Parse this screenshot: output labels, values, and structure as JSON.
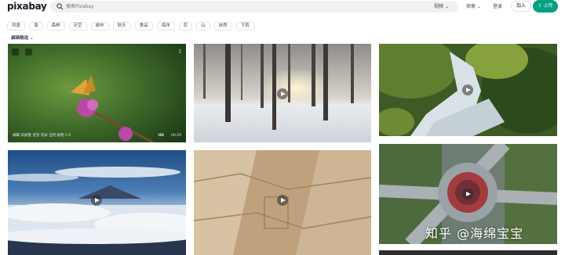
{
  "header": {
    "logo": "pixabay",
    "search_placeholder": "搜索Pixabay",
    "faint_tools": [
      "",
      "",
      "",
      "",
      "",
      "",
      "",
      ""
    ],
    "filter_label": "视频",
    "explore_label": "探索",
    "login_label": "登录",
    "join_label": "加入",
    "upload_label": "上传"
  },
  "tags": [
    "风景",
    "海",
    "森林",
    "天空",
    "城市",
    "秋天",
    "食品",
    "海洋",
    "花",
    "山",
    "自然",
    "下雨"
  ],
  "editor_label": "编辑精选",
  "cards": [
    {
      "duration": "00:29",
      "hd": "HD",
      "caption": "蝴蝶  高质量  昆虫  花朵 自然 植物 5  6"
    },
    {},
    {},
    {},
    {},
    {},
    {}
  ],
  "watermark": "知乎 @海绵宝宝",
  "colors": {
    "accent": "#05a081"
  }
}
